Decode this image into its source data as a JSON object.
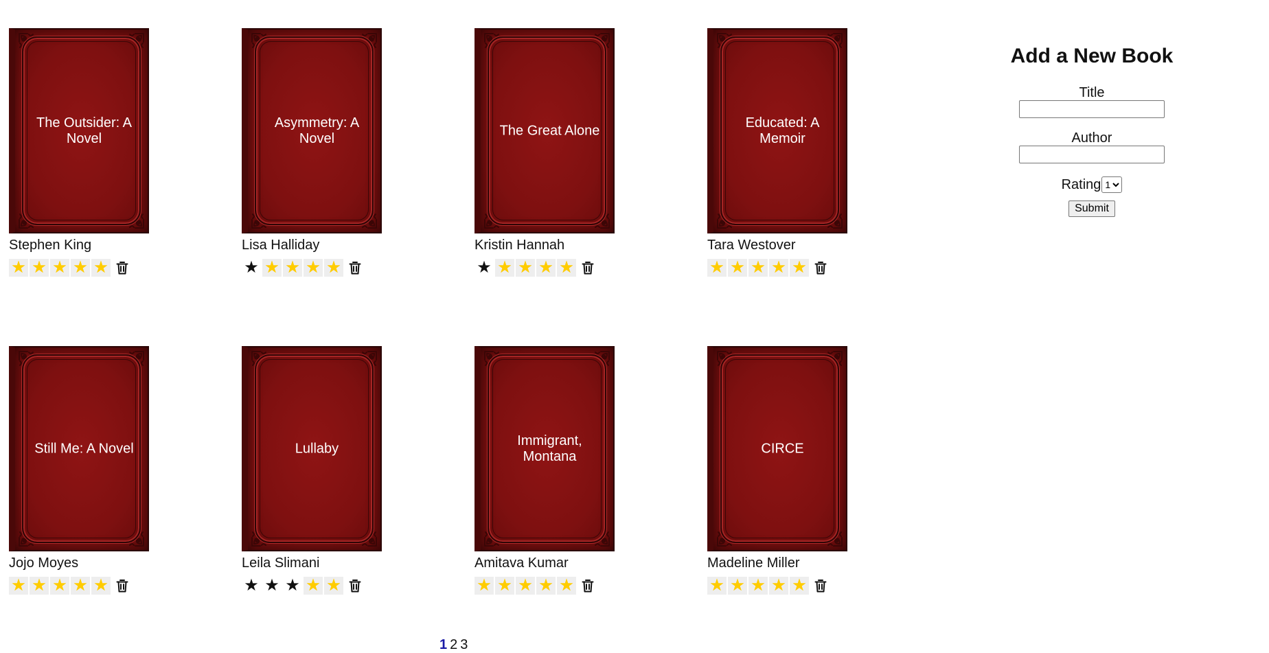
{
  "books": [
    {
      "title": "The Outsider: A Novel",
      "author": "Stephen King",
      "rating": 5
    },
    {
      "title": "Asymmetry: A Novel",
      "author": "Lisa Halliday",
      "rating": 4
    },
    {
      "title": "The Great Alone",
      "author": "Kristin Hannah",
      "rating": 4
    },
    {
      "title": "Educated: A Memoir",
      "author": "Tara Westover",
      "rating": 5
    },
    {
      "title": "Still Me: A Novel",
      "author": "Jojo Moyes",
      "rating": 5
    },
    {
      "title": "Lullaby",
      "author": "Leila Slimani",
      "rating": 2
    },
    {
      "title": "Immigrant, Montana",
      "author": "Amitava Kumar",
      "rating": 5
    },
    {
      "title": "CIRCE",
      "author": "Madeline Miller",
      "rating": 5
    }
  ],
  "pagination": {
    "pages": [
      "1",
      "2",
      "3"
    ],
    "current": "1"
  },
  "form": {
    "heading": "Add a New Book",
    "title_label": "Title",
    "title_value": "",
    "author_label": "Author",
    "author_value": "",
    "rating_label": "Rating",
    "rating_value": "1",
    "submit_label": "Submit"
  },
  "icons": {
    "star": "star-icon",
    "delete": "trash-icon"
  },
  "colors": {
    "cover": "#7e1010",
    "star_filled": "#ffcc00",
    "active_page": "#1a1aa6"
  }
}
